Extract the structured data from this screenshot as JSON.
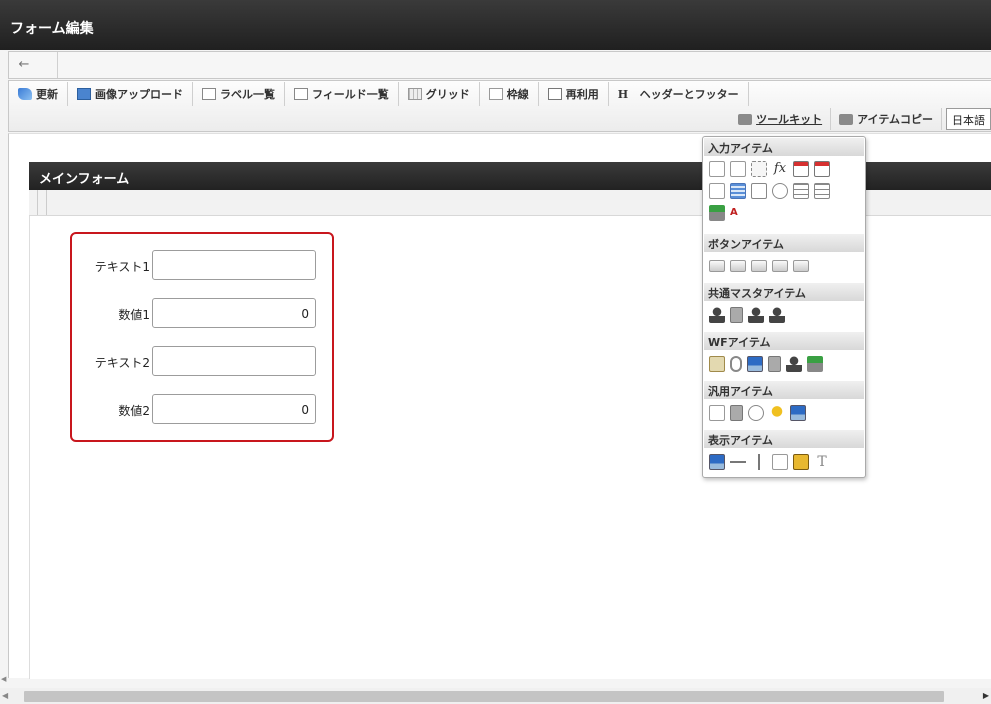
{
  "window": {
    "title": "フォーム編集"
  },
  "nav": {
    "back_icon": "←"
  },
  "toolbar": {
    "buttons": [
      {
        "label": "更新",
        "icon": "update-icon"
      },
      {
        "label": "画像アップロード",
        "icon": "image-upload-icon"
      },
      {
        "label": "ラベル一覧",
        "icon": "label-list-icon"
      },
      {
        "label": "フィールド一覧",
        "icon": "field-list-icon"
      },
      {
        "label": "グリッド",
        "icon": "grid-icon"
      },
      {
        "label": "枠線",
        "icon": "border-icon"
      },
      {
        "label": "再利用",
        "icon": "reuse-icon"
      },
      {
        "label": "ヘッダーとフッター",
        "icon": "header-footer-icon",
        "icon_text": "H"
      }
    ],
    "toolkit_label": "ツールキット",
    "item_copy_label": "アイテムコピー",
    "language": "日本語"
  },
  "panel": {
    "title": "メインフォーム"
  },
  "form": {
    "fields": [
      {
        "label": "テキスト1",
        "value": "",
        "type": "text"
      },
      {
        "label": "数値1",
        "value": "0",
        "type": "number"
      },
      {
        "label": "テキスト2",
        "value": "",
        "type": "text"
      },
      {
        "label": "数値2",
        "value": "0",
        "type": "number"
      }
    ],
    "highlight_color": "#c8161d"
  },
  "palette": {
    "sections": [
      {
        "title": "入力アイテム",
        "items": [
          "text-field-icon",
          "textarea-icon",
          "number-icon",
          "formula-icon",
          "date-icon",
          "datetime-icon",
          "pulldown-icon",
          "list-grid-icon",
          "checkbox-icon",
          "radio-icon",
          "listbox-icon",
          "multi-list-icon",
          "file-upload-icon",
          "font-icon"
        ]
      },
      {
        "title": "ボタンアイテム",
        "items": [
          "submit-button-icon",
          "next-button-icon",
          "back-button-icon",
          "return-button-icon",
          "forward-button-icon"
        ]
      },
      {
        "title": "共通マスタアイテム",
        "items": [
          "user-select-icon",
          "organization-select-icon",
          "role-select-icon",
          "company-select-icon"
        ]
      },
      {
        "title": "WFアイテム",
        "items": [
          "workflow-form-icon",
          "attachment-icon",
          "image-display-icon",
          "history-icon",
          "approver-icon",
          "stamp-icon"
        ]
      },
      {
        "title": "汎用アイテム",
        "items": [
          "hidden-icon",
          "document-icon",
          "camera-icon",
          "bulb-icon",
          "slideshow-icon"
        ]
      },
      {
        "title": "表示アイテム",
        "items": [
          "label-icon",
          "horizontal-line-icon",
          "vertical-line-icon",
          "box-icon",
          "image-icon",
          "text-icon"
        ],
        "text_glyph": "T"
      }
    ]
  },
  "colors": {
    "header_bg": "#2a2a2a",
    "accent_red": "#c8161d"
  }
}
